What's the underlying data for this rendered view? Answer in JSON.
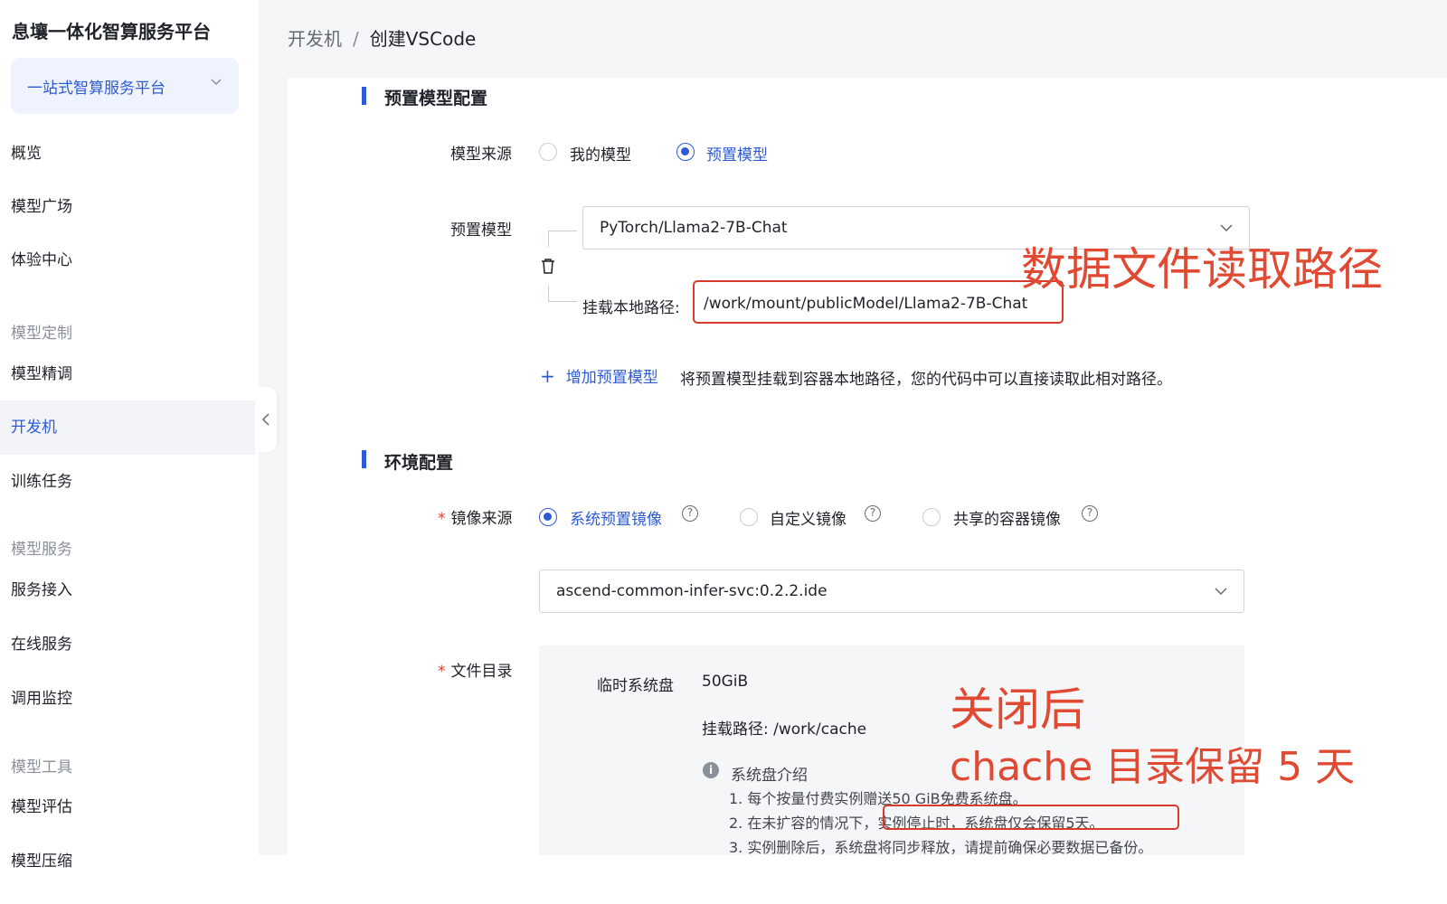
{
  "sidebar": {
    "brand": "息壤一体化智算服务平台",
    "platform_select": "一站式智算服务平台",
    "items": {
      "overview": "概览",
      "model_square": "模型广场",
      "experience_center": "体验中心",
      "group_customize": "模型定制",
      "fine_tune": "模型精调",
      "dev_machine": "开发机",
      "training_tasks": "训练任务",
      "group_service": "模型服务",
      "service_access": "服务接入",
      "online_service": "在线服务",
      "call_monitor": "调用监控",
      "group_tools": "模型工具",
      "model_eval": "模型评估",
      "model_compress": "模型压缩"
    }
  },
  "breadcrumb": {
    "parent": "开发机",
    "separator": "/",
    "current": "创建VSCode"
  },
  "preset_section": {
    "title": "预置模型配置",
    "source_label": "模型来源",
    "source_options": [
      "我的模型",
      "预置模型"
    ],
    "source_selected": "预置模型",
    "model_label": "预置模型",
    "model_value": "PyTorch/Llama2-7B-Chat",
    "mount_label": "挂载本地路径:",
    "mount_value": "/work/mount/publicModel/Llama2-7B-Chat",
    "add_link": "增加预置模型",
    "add_hint": "将预置模型挂载到容器本地路径，您的代码中可以直接读取此相对路径。"
  },
  "env_section": {
    "title": "环境配置",
    "image_label": "镜像来源",
    "image_options": [
      "系统预置镜像",
      "自定义镜像",
      "共享的容器镜像"
    ],
    "image_selected": "系统预置镜像",
    "image_value": "ascend-common-infer-svc:0.2.2.ide",
    "dir_label": "文件目录",
    "temp_disk_label": "临时系统盘",
    "temp_disk_value": "50GiB",
    "mount_path": "挂载路径:  /work/cache",
    "intro_title": "系统盘介绍",
    "notes": [
      "1. 每个按量付费实例赠送50 GiB免费系统盘。",
      "2. 在未扩容的情况下，实例停止时，系统盘仅会保留5天。",
      "3. 实例删除后，系统盘将同步释放，请提前确保必要数据已备份。"
    ]
  },
  "annotations": {
    "read_path": "数据文件读取路径",
    "after_close_line1": "关闭后",
    "after_close_line2": "chache 目录保留 5 天",
    "color": "#e04a33"
  },
  "icons": {
    "help": "?",
    "info": "i",
    "plus": "+"
  },
  "colors": {
    "accent": "#2d5bd6",
    "annotation_red": "#d93a2b",
    "required": "#e03e2d"
  }
}
